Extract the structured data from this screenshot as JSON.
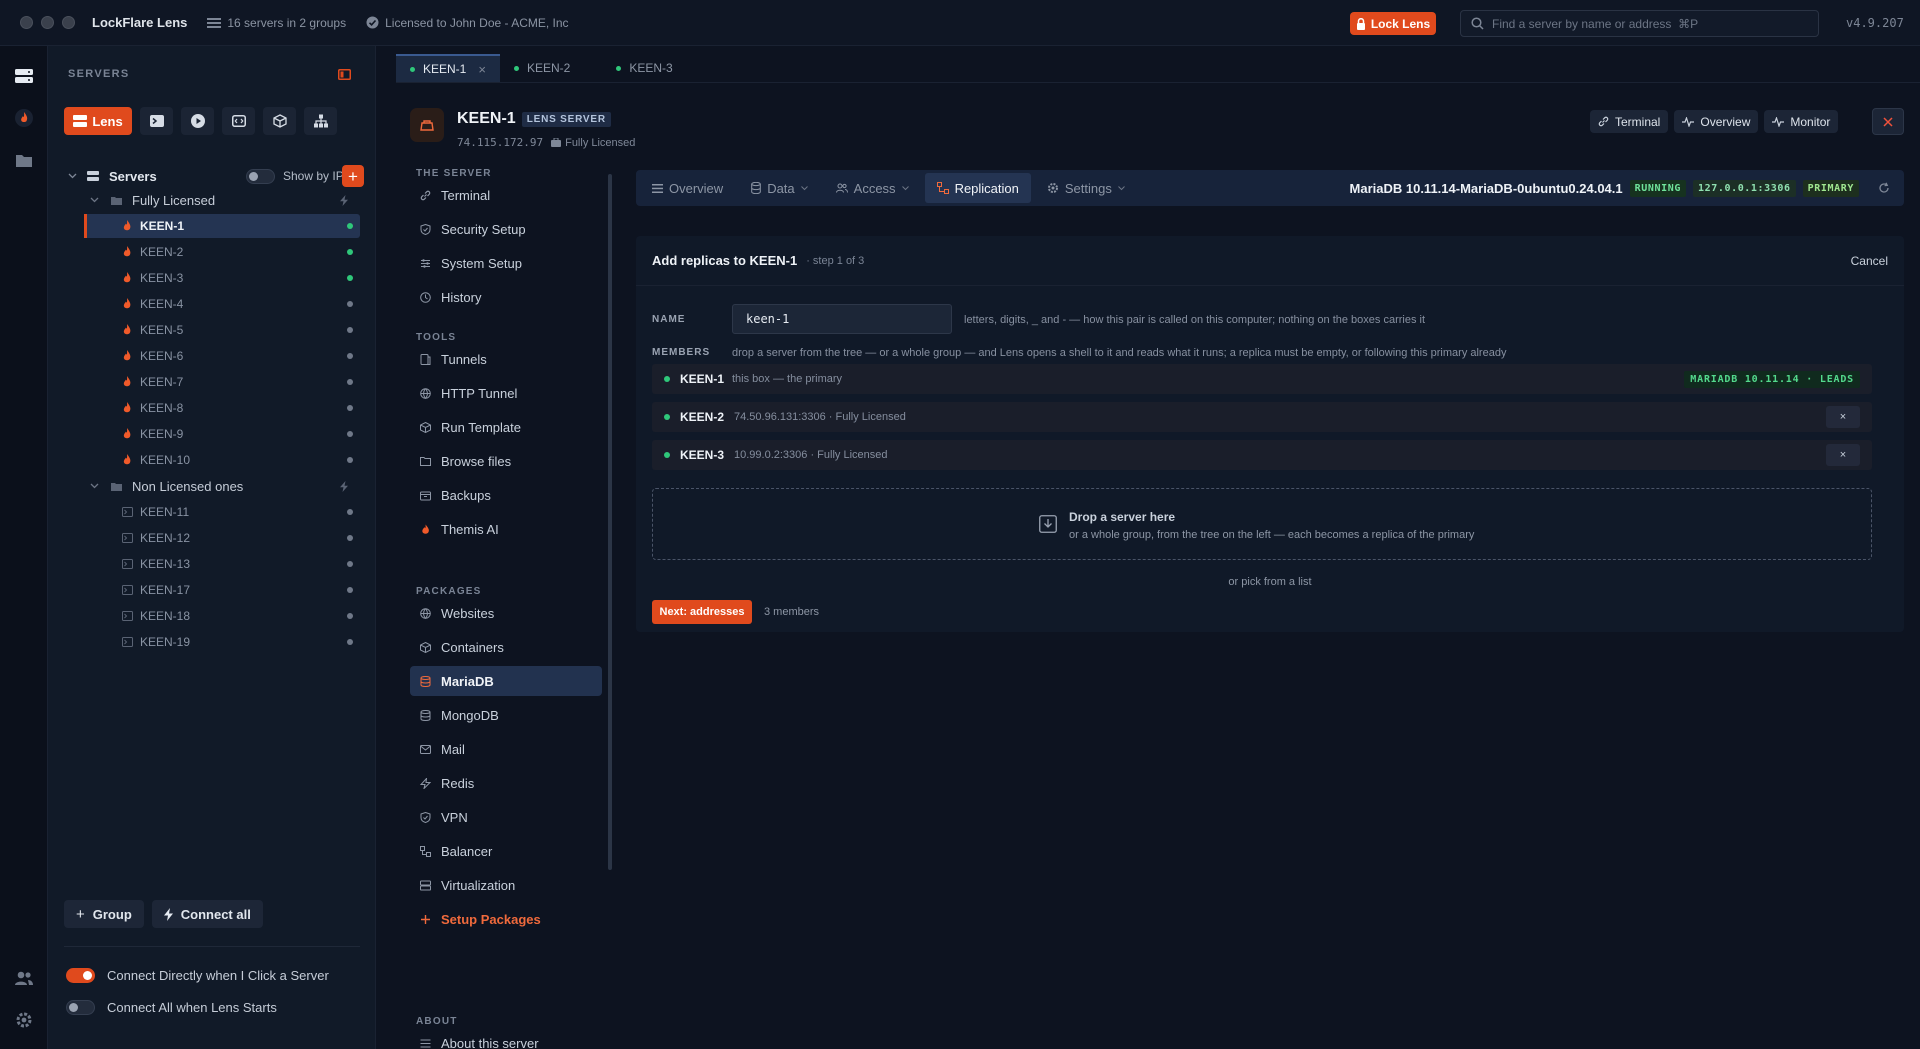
{
  "app": {
    "title": "LockFlare Lens",
    "server_count": "16 servers in 2 groups",
    "license": "Licensed to John Doe - ACME, Inc",
    "lock_label": "Lock Lens",
    "search_placeholder": "Find a server by name or address  ⌘P",
    "version": "v4.9.207"
  },
  "servers_panel": {
    "label": "SERVERS",
    "lens_label": "Lens",
    "root_label": "Servers",
    "show_by_ip": "Show by IP",
    "groups": [
      {
        "name": "Fully Licensed",
        "servers": [
          {
            "name": "KEEN-1",
            "status": "online"
          },
          {
            "name": "KEEN-2",
            "status": "online"
          },
          {
            "name": "KEEN-3",
            "status": "online"
          },
          {
            "name": "KEEN-4",
            "status": "offline"
          },
          {
            "name": "KEEN-5",
            "status": "offline"
          },
          {
            "name": "KEEN-6",
            "status": "offline"
          },
          {
            "name": "KEEN-7",
            "status": "offline"
          },
          {
            "name": "KEEN-8",
            "status": "offline"
          },
          {
            "name": "KEEN-9",
            "status": "offline"
          },
          {
            "name": "KEEN-10",
            "status": "offline"
          }
        ]
      },
      {
        "name": "Non Licensed ones",
        "servers": [
          {
            "name": "KEEN-11",
            "status": "offline"
          },
          {
            "name": "KEEN-12",
            "status": "offline"
          },
          {
            "name": "KEEN-13",
            "status": "offline"
          },
          {
            "name": "KEEN-17",
            "status": "offline"
          },
          {
            "name": "KEEN-18",
            "status": "offline"
          },
          {
            "name": "KEEN-19",
            "status": "offline"
          }
        ]
      }
    ],
    "group_button": "Group",
    "connect_all_button": "Connect all",
    "connect_directly": "Connect Directly when I Click a Server",
    "connect_all_on_start": "Connect All when Lens Starts"
  },
  "tabs": [
    {
      "label": "KEEN-1",
      "active": true
    },
    {
      "label": "KEEN-2",
      "active": false
    },
    {
      "label": "KEEN-3",
      "active": false
    }
  ],
  "server": {
    "name": "KEEN-1",
    "badge": "LENS SERVER",
    "ip": "74.115.172.97",
    "license": "Fully Licensed",
    "actions": {
      "terminal": "Terminal",
      "overview": "Overview",
      "monitor": "Monitor"
    }
  },
  "server_nav": {
    "the_server": {
      "label": "THE SERVER",
      "items": [
        "Terminal",
        "Security Setup",
        "System Setup",
        "History"
      ]
    },
    "tools": {
      "label": "TOOLS",
      "items": [
        "Tunnels",
        "HTTP Tunnel",
        "Run Template",
        "Browse files",
        "Backups",
        "Themis AI"
      ]
    },
    "packages": {
      "label": "PACKAGES",
      "items": [
        "Websites",
        "Containers",
        "MariaDB",
        "MongoDB",
        "Mail",
        "Redis",
        "VPN",
        "Balancer",
        "Virtualization",
        "Setup Packages"
      ]
    },
    "about": {
      "label": "ABOUT",
      "items": [
        "About this server"
      ]
    }
  },
  "main": {
    "tabs": [
      "Overview",
      "Data",
      "Access",
      "Replication",
      "Settings"
    ],
    "db_title": "MariaDB 10.11.14-MariaDB-0ubuntu0.24.04.1",
    "status_running": "RUNNING",
    "address": "127.0.0.1:3306",
    "role": "PRIMARY"
  },
  "wizard": {
    "title": "Add replicas to KEEN-1",
    "step": "· step 1 of 3",
    "cancel": "Cancel",
    "name_label": "NAME",
    "name_value": "keen-1",
    "name_hint": "letters, digits, _ and - — how this pair is called on this computer; nothing on the boxes carries it",
    "members_label": "MEMBERS",
    "members_hint": "drop a server from the tree — or a whole group — and Lens opens a shell to it and reads what it runs; a replica must be empty, or following this primary already",
    "members": [
      {
        "name": "KEEN-1",
        "desc": "this box — the primary",
        "badge": "MARIADB 10.11.14 · LEADS"
      },
      {
        "name": "KEEN-2",
        "desc": "74.50.96.131:3306 · Fully Licensed",
        "remove": "×"
      },
      {
        "name": "KEEN-3",
        "desc": "10.99.0.2:3306 · Fully Licensed",
        "remove": "×"
      }
    ],
    "drop_title": "Drop a server here",
    "drop_sub": "or a whole group, from the tree on the left — each becomes a replica of the primary",
    "pick_list": "or pick from a list",
    "next_button": "Next: addresses",
    "member_count": "3 members"
  },
  "colors": {
    "accent": "#e04a1d",
    "online": "#2fc77a",
    "selected": "#243452"
  }
}
